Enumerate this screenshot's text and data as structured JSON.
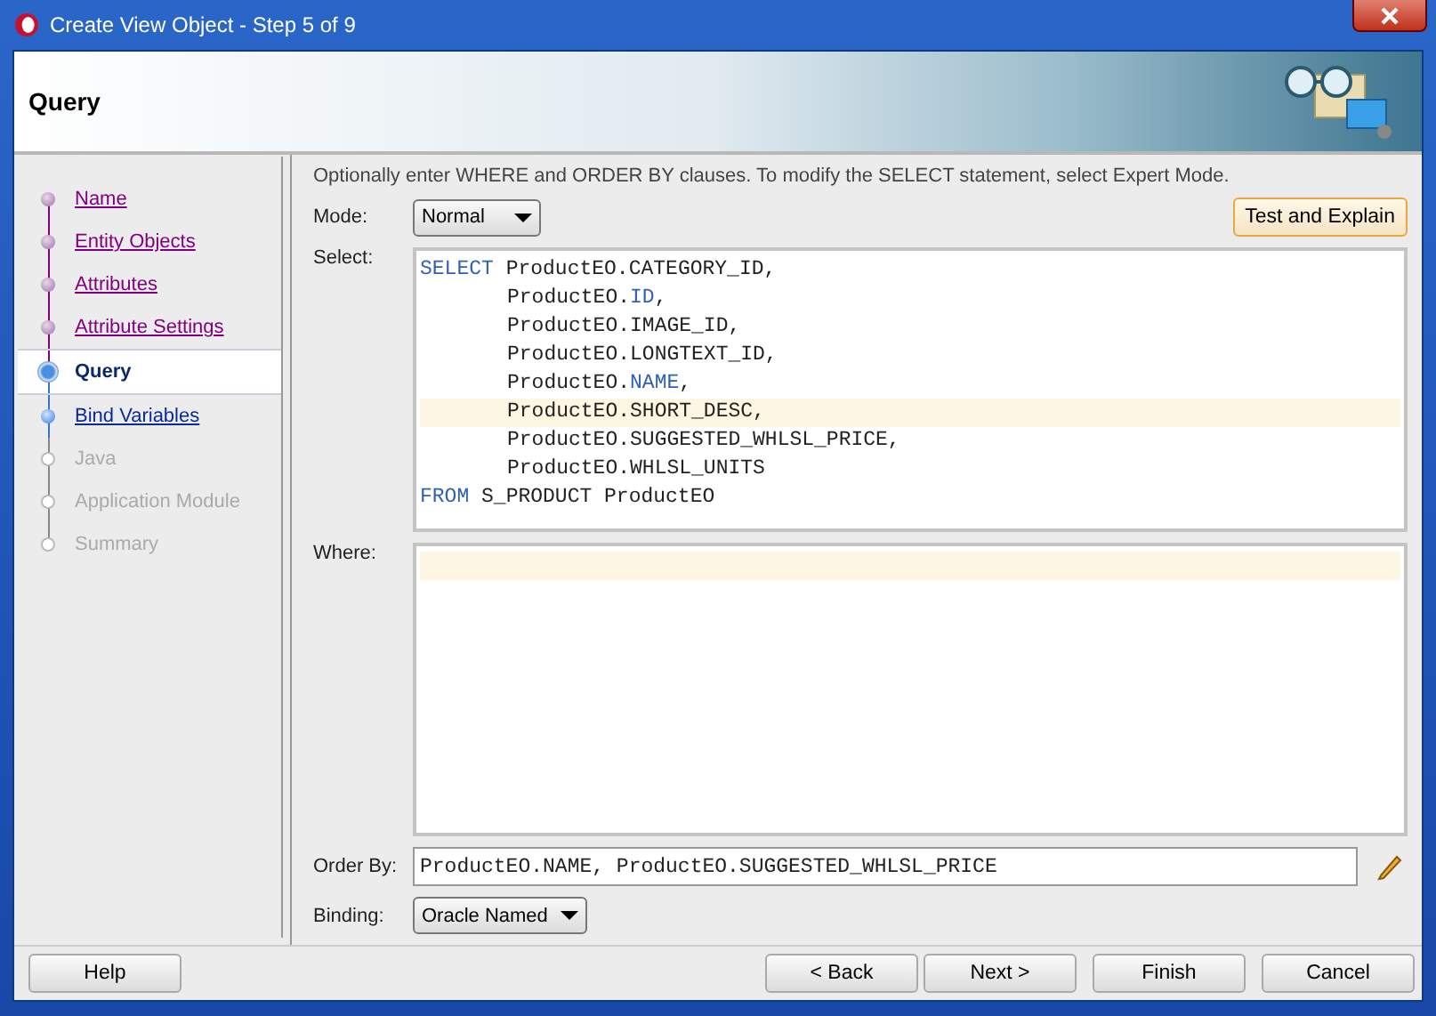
{
  "window": {
    "title": "Create View Object - Step 5 of 9"
  },
  "header": {
    "title": "Query"
  },
  "steps": [
    {
      "label": "Name",
      "selected": false,
      "visited": true,
      "disabled": false
    },
    {
      "label": "Entity Objects",
      "selected": false,
      "visited": true,
      "disabled": false
    },
    {
      "label": "Attributes",
      "selected": false,
      "visited": true,
      "disabled": false
    },
    {
      "label": "Attribute Settings",
      "selected": false,
      "visited": true,
      "disabled": false
    },
    {
      "label": "Query",
      "selected": true,
      "visited": false,
      "disabled": false
    },
    {
      "label": "Bind Variables",
      "selected": false,
      "visited": false,
      "disabled": false
    },
    {
      "label": "Java",
      "selected": false,
      "visited": false,
      "disabled": true
    },
    {
      "label": "Application Module",
      "selected": false,
      "visited": false,
      "disabled": true
    },
    {
      "label": "Summary",
      "selected": false,
      "visited": false,
      "disabled": true
    }
  ],
  "instructions": "Optionally enter WHERE and ORDER BY clauses. To modify the SELECT statement, select Expert Mode.",
  "mode": {
    "label": "Mode:",
    "value": "Normal"
  },
  "test_button": "Test and Explain",
  "select": {
    "label": "Select:",
    "lines": [
      {
        "indented": false,
        "highlighted": false,
        "tokens": [
          {
            "text": "SELECT",
            "kind": "keyword"
          },
          {
            "text": " ProductEO.CATEGORY_ID,",
            "kind": "plain"
          }
        ]
      },
      {
        "indented": true,
        "highlighted": false,
        "tokens": [
          {
            "text": "ProductEO.",
            "kind": "plain"
          },
          {
            "text": "ID",
            "kind": "keyword"
          },
          {
            "text": ",",
            "kind": "plain"
          }
        ]
      },
      {
        "indented": true,
        "highlighted": false,
        "tokens": [
          {
            "text": "ProductEO.IMAGE_ID,",
            "kind": "plain"
          }
        ]
      },
      {
        "indented": true,
        "highlighted": false,
        "tokens": [
          {
            "text": "ProductEO.LONGTEXT_ID,",
            "kind": "plain"
          }
        ]
      },
      {
        "indented": true,
        "highlighted": false,
        "tokens": [
          {
            "text": "ProductEO.",
            "kind": "plain"
          },
          {
            "text": "NAME",
            "kind": "keyword"
          },
          {
            "text": ",",
            "kind": "plain"
          }
        ]
      },
      {
        "indented": true,
        "highlighted": true,
        "tokens": [
          {
            "text": "ProductEO.SHORT_DESC,",
            "kind": "plain"
          }
        ]
      },
      {
        "indented": true,
        "highlighted": false,
        "tokens": [
          {
            "text": "ProductEO.SUGGESTED_WHLSL_PRICE,",
            "kind": "plain"
          }
        ]
      },
      {
        "indented": true,
        "highlighted": false,
        "tokens": [
          {
            "text": "ProductEO.WHLSL_UNITS",
            "kind": "plain"
          }
        ]
      },
      {
        "indented": false,
        "highlighted": false,
        "tokens": [
          {
            "text": "FROM",
            "kind": "keyword"
          },
          {
            "text": " S_PRODUCT ProductEO",
            "kind": "plain"
          }
        ]
      }
    ]
  },
  "where": {
    "label": "Where:",
    "current_line_highlighted": true
  },
  "order_by": {
    "label": "Order By:",
    "value": "ProductEO.NAME, ProductEO.SUGGESTED_WHLSL_PRICE"
  },
  "binding": {
    "label": "Binding:",
    "value": "Oracle Named"
  },
  "buttons": {
    "help": "Help",
    "back": "< Back",
    "next": "Next >",
    "finish": "Finish",
    "cancel": "Cancel"
  }
}
